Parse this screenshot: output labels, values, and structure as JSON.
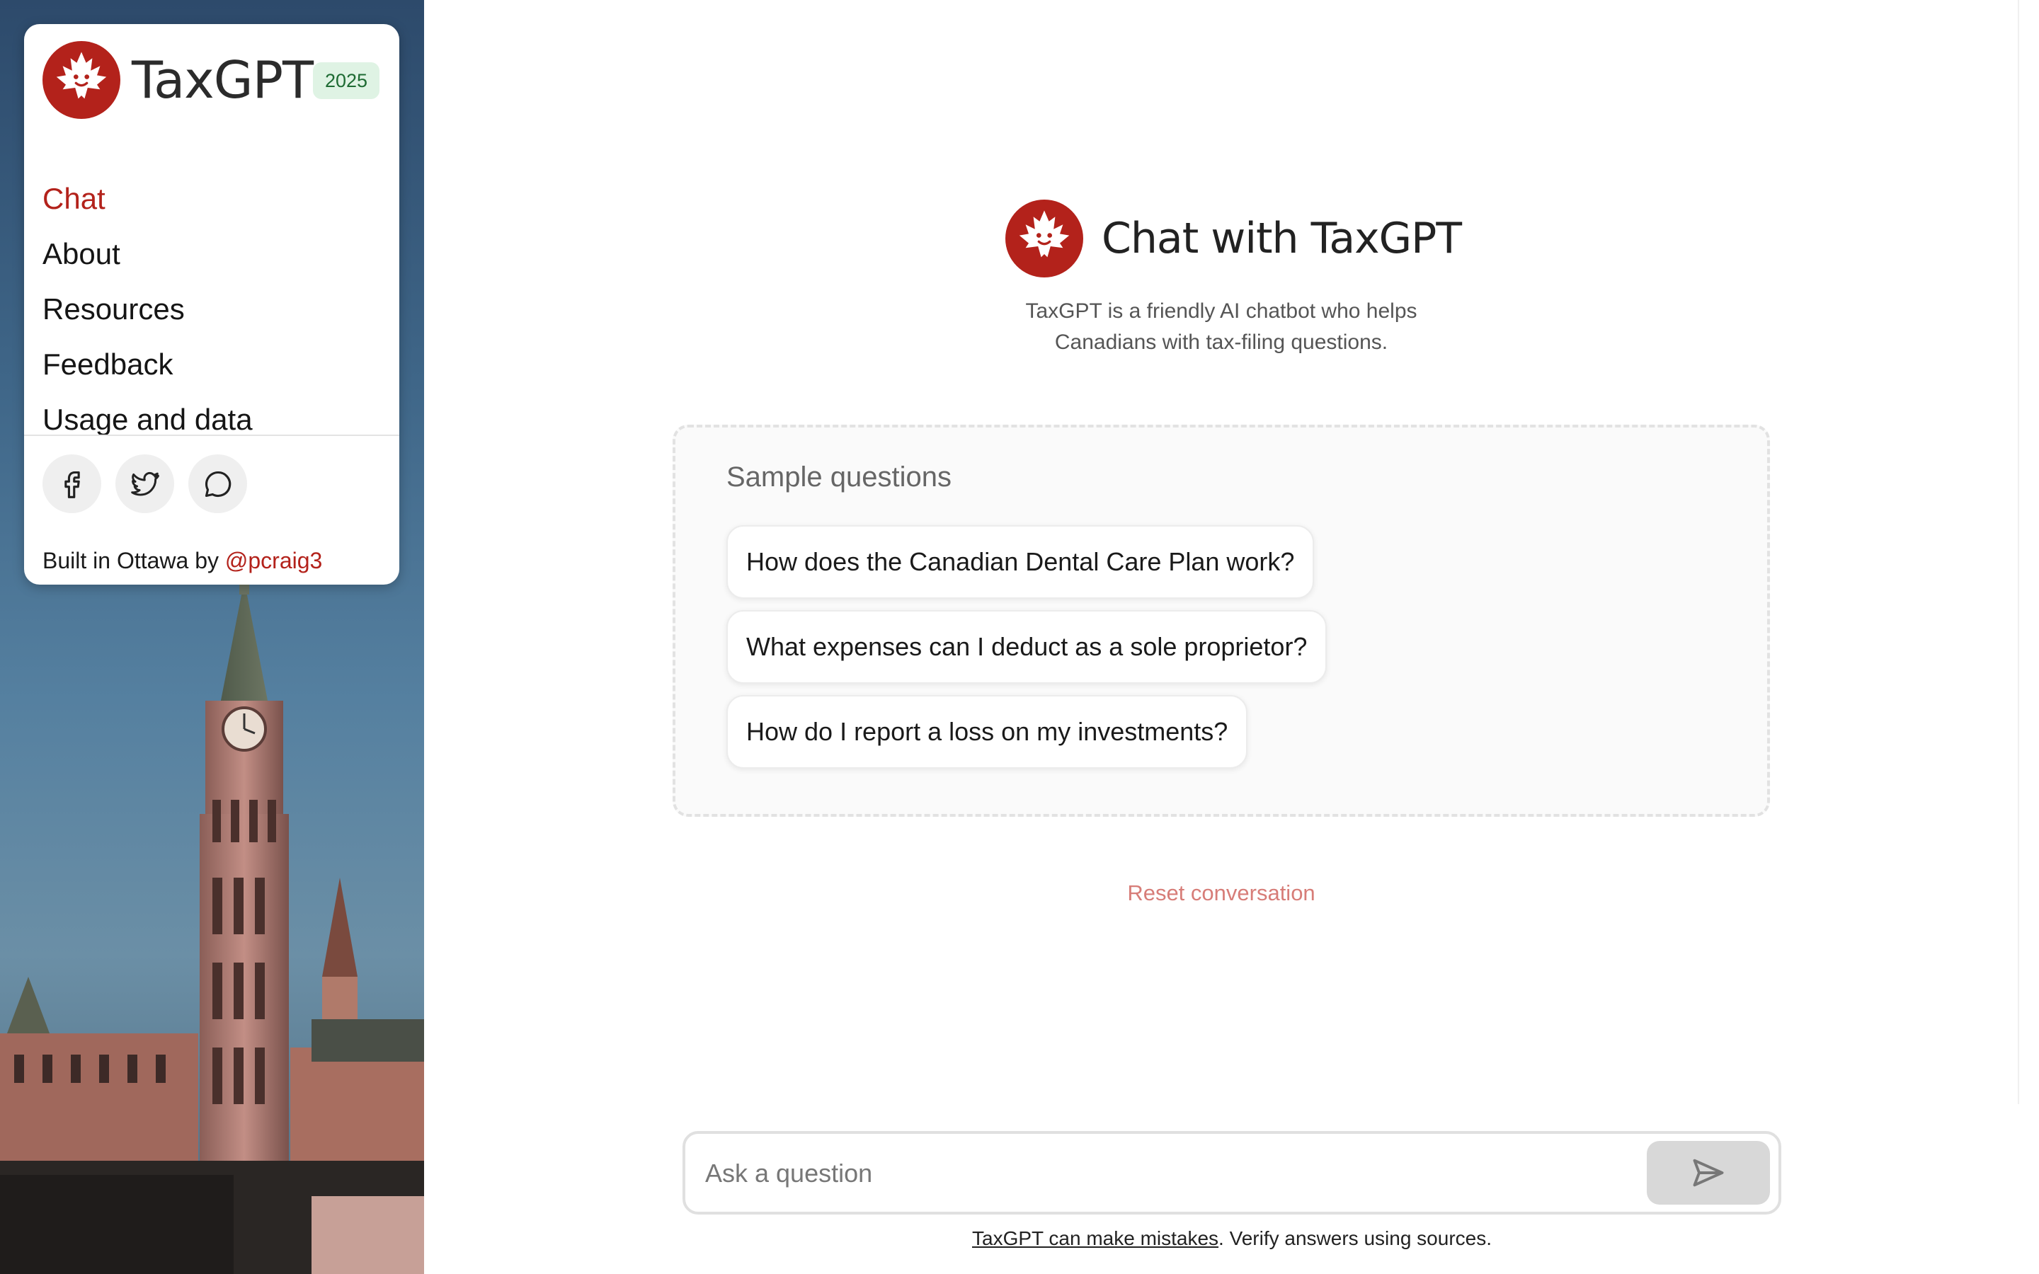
{
  "sidebar": {
    "brand_name": "TaxGPT",
    "year_badge": "2025",
    "nav": [
      {
        "label": "Chat",
        "active": true
      },
      {
        "label": "About",
        "active": false
      },
      {
        "label": "Resources",
        "active": false
      },
      {
        "label": "Feedback",
        "active": false
      },
      {
        "label": "Usage and data",
        "active": false
      }
    ],
    "socials": [
      "facebook-icon",
      "twitter-icon",
      "message-icon"
    ],
    "credit_prefix": "Built in Ottawa by ",
    "credit_handle": "@pcraig3"
  },
  "hero": {
    "title": "Chat with TaxGPT",
    "subtitle_line1": "TaxGPT is a friendly AI chatbot who helps",
    "subtitle_line2": "Canadians with tax-filing questions."
  },
  "samples": {
    "title": "Sample questions",
    "questions": [
      "How does the Canadian Dental Care Plan work?",
      "What expenses can I deduct as a sole proprietor?",
      "How do I report a loss on my investments?"
    ]
  },
  "reset_label": "Reset conversation",
  "input": {
    "placeholder": "Ask a question",
    "value": ""
  },
  "disclaimer": {
    "link": "TaxGPT can make mistakes",
    "rest": ". Verify answers using sources."
  },
  "colors": {
    "brand_red": "#b3221b",
    "badge_bg": "#dff3e4",
    "reset_text": "#d77d78"
  }
}
